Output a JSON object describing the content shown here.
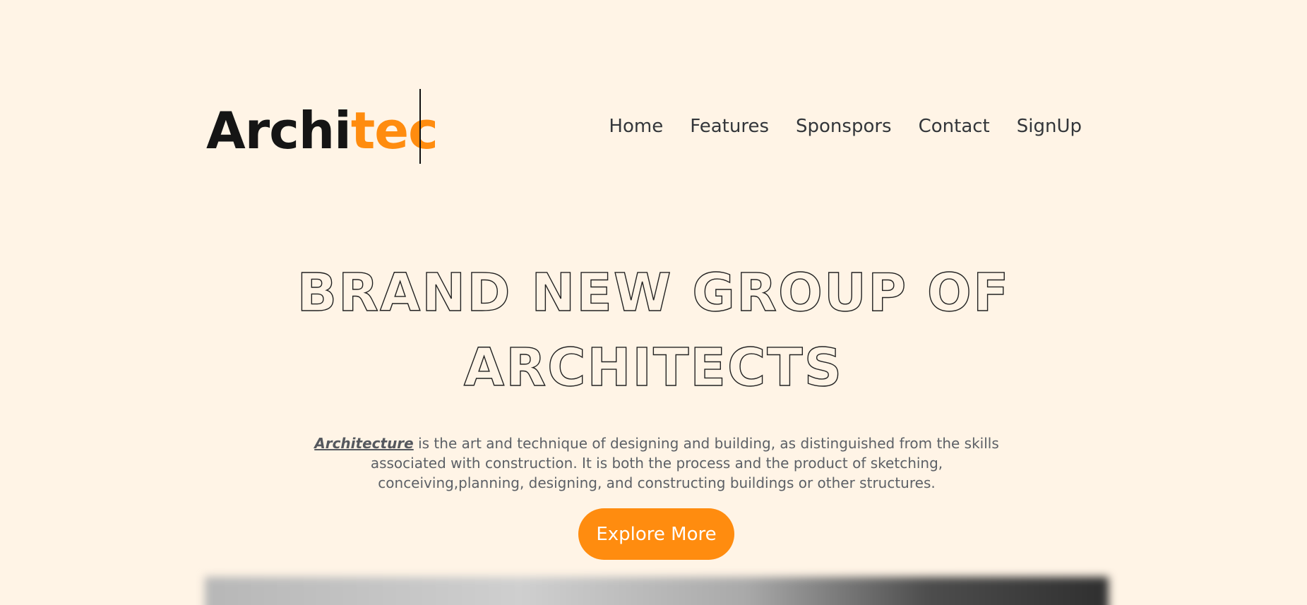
{
  "header": {
    "logo": {
      "part1": "Archi",
      "part2": "tec"
    },
    "nav": {
      "home": "Home",
      "features": "Features",
      "sponsors": "Sponspors",
      "contact": "Contact",
      "signup": "SignUp"
    }
  },
  "hero": {
    "title_line1": "BRAND NEW GROUP OF",
    "title_line2": "ARCHITECTS",
    "description_term": "Architecture",
    "description_rest": " is the art and technique of designing and building, as distinguished from the skills associated with construction. It is both the process and the product of sketching, conceiving,planning, designing, and constructing buildings or other structures.",
    "cta_label": "Explore More"
  },
  "colors": {
    "background": "#fff4e6",
    "accent": "#ff8c0f",
    "text_dark": "#151515"
  }
}
